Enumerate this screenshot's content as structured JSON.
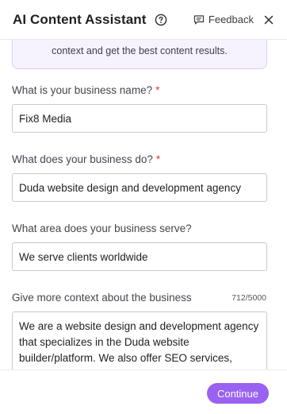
{
  "header": {
    "title": "AI Content Assistant",
    "help_icon": "help-circle-icon",
    "feedback_label": "Feedback",
    "feedback_icon": "message-square-icon",
    "close_icon": "close-icon"
  },
  "info": {
    "text": "context and get the best content results."
  },
  "fields": {
    "business_name": {
      "label": "What is your business name?",
      "required_mark": "*",
      "value": "Fix8 Media"
    },
    "business_does": {
      "label": "What does your business do?",
      "required_mark": "*",
      "value": "Duda website design and development agency"
    },
    "business_area": {
      "label": "What area does your business serve?",
      "value": "We serve clients worldwide"
    },
    "business_context": {
      "label": "Give more context about the business",
      "counter": "712/5000",
      "value": "We are a website design and development agency that specializes in the Duda website builder/platform. We also offer SEO services,"
    }
  },
  "footer": {
    "continue_label": "Continue"
  },
  "colors": {
    "accent": "#9a62f0",
    "info_bg": "#f6f3fe",
    "required": "#e0383e"
  }
}
